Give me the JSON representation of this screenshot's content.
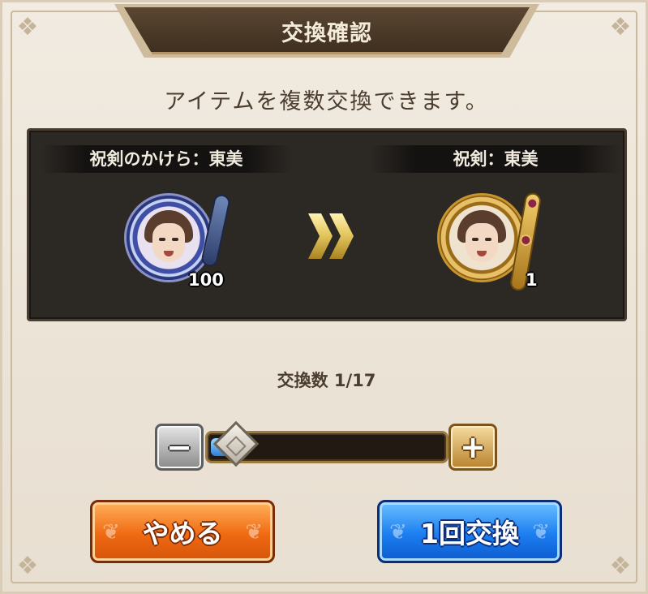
{
  "dialog": {
    "title": "交換確認",
    "subtitle": "アイテムを複数交換できます。"
  },
  "exchange": {
    "source": {
      "name": "祝剣のかけら：東美",
      "count": "100",
      "icon": "shard-portrait-icon"
    },
    "target": {
      "name": "祝剣：東美",
      "count": "1",
      "icon": "sword-portrait-icon"
    },
    "arrow_icon": "double-chevron-right-icon"
  },
  "quantity": {
    "label": "交換数 1/17",
    "current": 1,
    "max": 17,
    "minus_icon": "minus-icon",
    "plus_icon": "plus-icon"
  },
  "buttons": {
    "cancel_label": "やめる",
    "confirm_label": "1回交換"
  },
  "colors": {
    "panel_bg": "#2c2824",
    "cancel_orange": "#f06a12",
    "confirm_blue": "#1c7ef0",
    "slider_fill_blue": "#2f7fd8"
  }
}
